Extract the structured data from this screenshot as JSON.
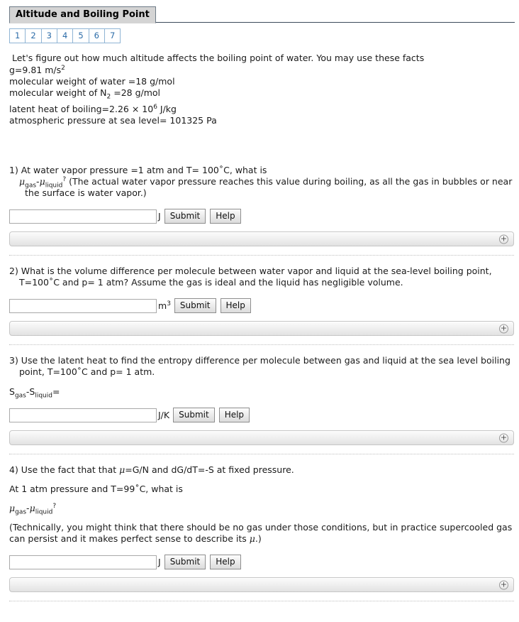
{
  "header": {
    "title": "Altitude and Boiling Point",
    "page_tabs": [
      "1",
      "2",
      "3",
      "4",
      "5",
      "6",
      "7"
    ],
    "accent_line_color": "#3b4a5a",
    "tab_text_color": "#2c6ca8"
  },
  "intro": {
    "lead": "Let's figure out how much altitude affects the boiling point of water. You may use these facts",
    "fact_g_pre": "g=9.81 m/s",
    "fact_g_sup": "2",
    "fact_water_mw": "molecular weight of water =18 g/mol",
    "fact_n2_pre": "molecular weight of N",
    "fact_n2_sub": "2",
    "fact_n2_post": " =28 g/mol",
    "fact_latent_pre": "latent heat of boiling=2.26 × 10",
    "fact_latent_sup": "6",
    "fact_latent_post": " J/kg",
    "fact_pressure": "atmospheric pressure at sea level= 101325 Pa"
  },
  "questions": [
    {
      "line1": "1) At water vapor pressure =1 atm and T= 100˚C, what is",
      "mu1": "μ",
      "sub1": "gas",
      "dash": "-",
      "mu2": "μ",
      "sub2": "liquid",
      "sup_q": "?",
      "line2_rest": " (The actual water vapor pressure reaches this value during boiling, as all the gas in bubbles or near the surface is water vapor.)",
      "unit": "J",
      "submit_label": "Submit",
      "help_label": "Help",
      "input_value": "",
      "input_placeholder": "",
      "expand_icon": "plus-circle-icon"
    },
    {
      "line1": "2) What is the volume difference per molecule between water vapor and liquid at the sea-level boiling point, T=100˚C and p= 1 atm? Assume the gas is ideal and the liquid has negligible volume.",
      "unit_pre": "m",
      "unit_sup": "3",
      "submit_label": "Submit",
      "help_label": "Help",
      "input_value": "",
      "input_placeholder": "",
      "expand_icon": "plus-circle-icon"
    },
    {
      "line1": "3) Use the latent heat to find the entropy difference per molecule between gas and liquid at the sea level boiling point, T=100˚C and p= 1 atm.",
      "formula_s1": "S",
      "formula_sub1": "gas",
      "formula_dash": "-S",
      "formula_sub2": "liquid",
      "formula_eq": "=",
      "unit": "J/K",
      "submit_label": "Submit",
      "help_label": "Help",
      "input_value": "",
      "input_placeholder": "",
      "expand_icon": "plus-circle-icon"
    },
    {
      "line1_pre": "4) Use the fact that that ",
      "line1_mu": "μ",
      "line1_post": "=G/N and dG/dT=-S at fixed pressure.",
      "line2": "At 1 atm pressure and T=99˚C, what is",
      "mu1": "μ",
      "sub1": "gas",
      "dash": "-",
      "mu2": "μ",
      "sub2": "liquid",
      "sup_q": "?",
      "note_pre": "(Technically, you might think that there should be no gas under those conditions, but in practice supercooled gas can persist and it makes perfect sense to describe its ",
      "note_mu": "μ",
      "note_post": ".)",
      "unit": "J",
      "submit_label": "Submit",
      "help_label": "Help",
      "input_value": "",
      "input_placeholder": "",
      "expand_icon": "plus-circle-icon"
    }
  ]
}
